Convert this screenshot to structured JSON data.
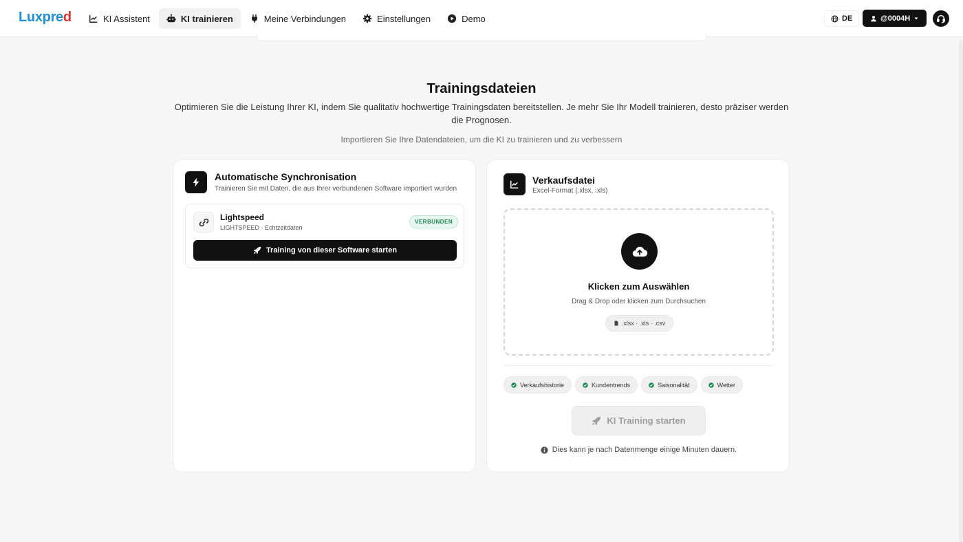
{
  "app": {
    "logo_text": "Luxpred",
    "nav": [
      {
        "label": "KI Assistent",
        "icon": "chart-line-icon"
      },
      {
        "label": "KI trainieren",
        "icon": "robot-icon",
        "active": true
      },
      {
        "label": "Meine Verbindungen",
        "icon": "plug-icon"
      },
      {
        "label": "Einstellungen",
        "icon": "gear-icon"
      },
      {
        "label": "Demo",
        "icon": "play-circle-icon"
      }
    ],
    "language": "DE",
    "user": "@0004H"
  },
  "page": {
    "title": "Trainingsdateien",
    "description": "Optimieren Sie die Leistung Ihrer KI, indem Sie qualitativ hochwertige Trainingsdaten bereitstellen. Je mehr Sie Ihr Modell trainieren, desto präziser werden die Prognosen.",
    "subtitle": "Importieren Sie Ihre Datendateien, um die KI zu trainieren und zu verbessern"
  },
  "sync_card": {
    "title": "Automatische Synchronisation",
    "subtitle": "Trainieren Sie mit Daten, die aus Ihrer verbundenen Software importiert wurden",
    "software": {
      "name": "Lightspeed",
      "meta": "LIGHTSPEED · Echtzeitdaten",
      "status": "VERBUNDEN",
      "button_label": "Training von dieser Software starten"
    }
  },
  "sales_card": {
    "title": "Verkaufsdatei",
    "subtitle": "Excel-Format (.xlsx, .xls)",
    "dropzone": {
      "title": "Klicken zum Auswählen",
      "subtitle": "Drag & Drop oder klicken zum Durchsuchen",
      "formats": ".xlsx · .xls · .csv"
    },
    "tags": [
      "Verkaufshistorie",
      "Kundentrends",
      "Saisonalität",
      "Wetter"
    ],
    "train_button": "KI Training starten",
    "note": "Dies kann je nach Datenmenge einige Minuten dauern."
  },
  "colors": {
    "logo_blue": "#1f8fd6",
    "logo_red": "#e0332f",
    "primary": "#111111",
    "success": "#1e8a55"
  }
}
